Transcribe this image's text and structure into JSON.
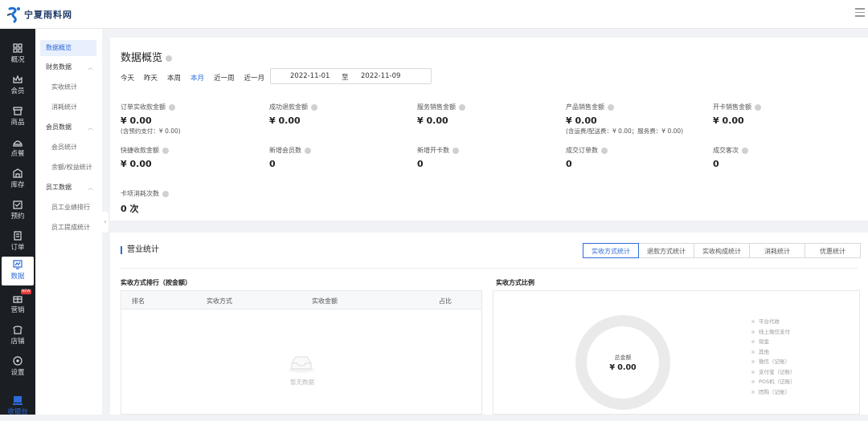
{
  "app": {
    "logo_text": "宁夏雨料网"
  },
  "rail": [
    {
      "label": "概况",
      "icon": "grid-icon"
    },
    {
      "label": "会员",
      "icon": "crown-icon"
    },
    {
      "label": "商品",
      "icon": "shop-icon"
    },
    {
      "label": "点餐",
      "icon": "dish-icon"
    },
    {
      "label": "库存",
      "icon": "warehouse-icon"
    },
    {
      "label": "预约",
      "icon": "calendar-check-icon"
    },
    {
      "label": "订单",
      "icon": "order-icon"
    },
    {
      "label": "数据",
      "icon": "chart-monitor-icon"
    },
    {
      "label": "营销",
      "icon": "gift-icon",
      "badge": "NEW"
    },
    {
      "label": "店铺",
      "icon": "store-icon"
    },
    {
      "label": "设置",
      "icon": "settings-icon"
    },
    {
      "label": "收银台",
      "icon": "cashier-icon"
    }
  ],
  "submenu": {
    "overview": "数据概览",
    "finance": "财务数据",
    "revenue": "实收统计",
    "consume": "消耗统计",
    "member": "会员数据",
    "member_stats": "会员统计",
    "balance": "余额/权益统计",
    "staff": "员工数据",
    "staff_rank": "员工业绩排行",
    "staff_commission": "员工提成统计"
  },
  "overview": {
    "title": "数据概览",
    "ranges": [
      "今天",
      "昨天",
      "本周",
      "本月",
      "近一周",
      "近一月"
    ],
    "active_range": "本月",
    "date_start": "2022-11-01",
    "date_sep": "至",
    "date_end": "2022-11-09"
  },
  "metrics": [
    {
      "label": "订单实收款金额",
      "value": "¥ 0.00",
      "note": "(含预约支付：¥ 0.00)"
    },
    {
      "label": "成功退款金额",
      "value": "¥ 0.00",
      "note": ""
    },
    {
      "label": "服务销售金额",
      "value": "¥ 0.00",
      "note": ""
    },
    {
      "label": "产品销售金额",
      "value": "¥ 0.00",
      "note": "(含运费/配送费：¥ 0.00；服务费：¥ 0.00)"
    },
    {
      "label": "开卡销售金额",
      "value": "¥ 0.00",
      "note": ""
    },
    {
      "label": "快捷收款金额",
      "value": "¥ 0.00",
      "note": ""
    },
    {
      "label": "新增会员数",
      "value": "0",
      "note": ""
    },
    {
      "label": "新增开卡数",
      "value": "0",
      "note": ""
    },
    {
      "label": "成交订单数",
      "value": "0",
      "note": ""
    },
    {
      "label": "成交客次",
      "value": "0",
      "note": ""
    },
    {
      "label": "卡项消耗次数",
      "value": "0 次",
      "note": ""
    }
  ],
  "business": {
    "title": "营业统计",
    "tabs": [
      "实收方式统计",
      "退款方式统计",
      "实收构成统计",
      "消耗统计",
      "优惠统计"
    ],
    "active_tab": "实收方式统计",
    "rank_title": "实收方式排行（按金额）",
    "columns": [
      "排名",
      "实收方式",
      "实收金额",
      "占比"
    ],
    "empty": "暂无数据",
    "ratio_title": "实收方式比例",
    "total_label": "总金额",
    "total_value": "¥ 0.00",
    "legend": [
      "平台代收",
      "线上微信支付",
      "现金",
      "其他",
      "微信（记账）",
      "支付宝（记账）",
      "POS机（记账）",
      "团购（记账）"
    ]
  }
}
